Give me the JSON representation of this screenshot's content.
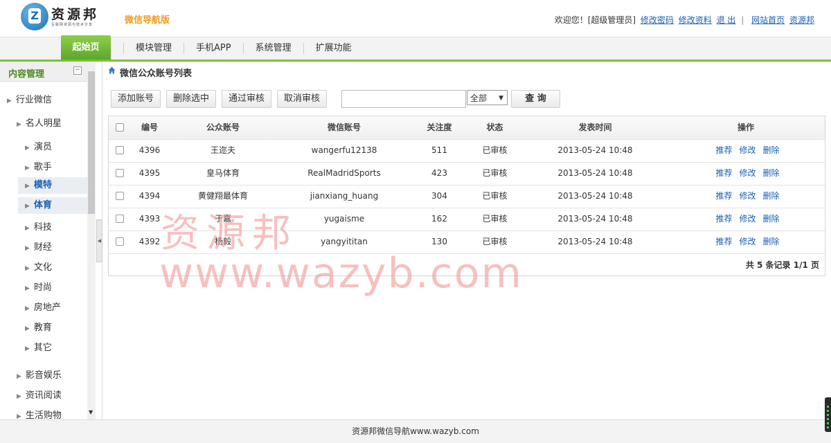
{
  "header": {
    "logo_text": "资源邦",
    "logo_sub": "互联网资源与技术分享",
    "subtitle": "微信导航版",
    "welcome": "欢迎您！[超级管理员]",
    "links": [
      "修改密码",
      "修改资料",
      "退 出"
    ],
    "site_links": [
      "网站首页",
      "资源邦"
    ]
  },
  "nav": {
    "start": "起始页",
    "items": [
      "模块管理",
      "手机APP",
      "系统管理",
      "扩展功能"
    ]
  },
  "sidebar": {
    "title": "内容管理",
    "tree": {
      "l1": "行业微信",
      "l2": "名人明星",
      "children": [
        "演员",
        "歌手",
        "模特",
        "体育",
        "科技",
        "财经",
        "文化",
        "时尚",
        "房地产",
        "教育",
        "其它"
      ],
      "bottom": [
        "影音娱乐",
        "资讯阅读",
        "生活购物"
      ]
    }
  },
  "main": {
    "title": "微信公众账号列表",
    "buttons": [
      "添加账号",
      "删除选中",
      "通过审核",
      "取消审核"
    ],
    "search_value": "",
    "filter_selected": "全部",
    "query": "查 询",
    "columns": [
      "编号",
      "公众账号",
      "微信账号",
      "关注度",
      "状态",
      "发表时间",
      "操作"
    ],
    "rows": [
      {
        "id": "4396",
        "name": "王迩夫",
        "wx": "wangerfu12138",
        "follow": "511",
        "status": "已审核",
        "time": "2013-05-24 10:48"
      },
      {
        "id": "4395",
        "name": "皇马体育",
        "wx": "RealMadridSports",
        "follow": "423",
        "status": "已审核",
        "time": "2013-05-24 10:48"
      },
      {
        "id": "4394",
        "name": "黄健翔最体育",
        "wx": "jianxiang_huang",
        "follow": "304",
        "status": "已审核",
        "time": "2013-05-24 10:48"
      },
      {
        "id": "4393",
        "name": "于嘉",
        "wx": "yugaisme",
        "follow": "162",
        "status": "已审核",
        "time": "2013-05-24 10:48"
      },
      {
        "id": "4392",
        "name": "杨毅",
        "wx": "yangyititan",
        "follow": "130",
        "status": "已审核",
        "time": "2013-05-24 10:48"
      }
    ],
    "row_ops": [
      "推荐",
      "修改",
      "删除"
    ],
    "pager": "共 5 条记录 1/1 页"
  },
  "footer": "资源邦微信导航www.wazyb.com",
  "watermark": [
    "资源邦",
    "www.wazyb.com"
  ],
  "colors": {
    "accent_green": "#6cb732",
    "link_blue": "#1a5fb4",
    "subtitle_orange": "#f39a1d"
  }
}
